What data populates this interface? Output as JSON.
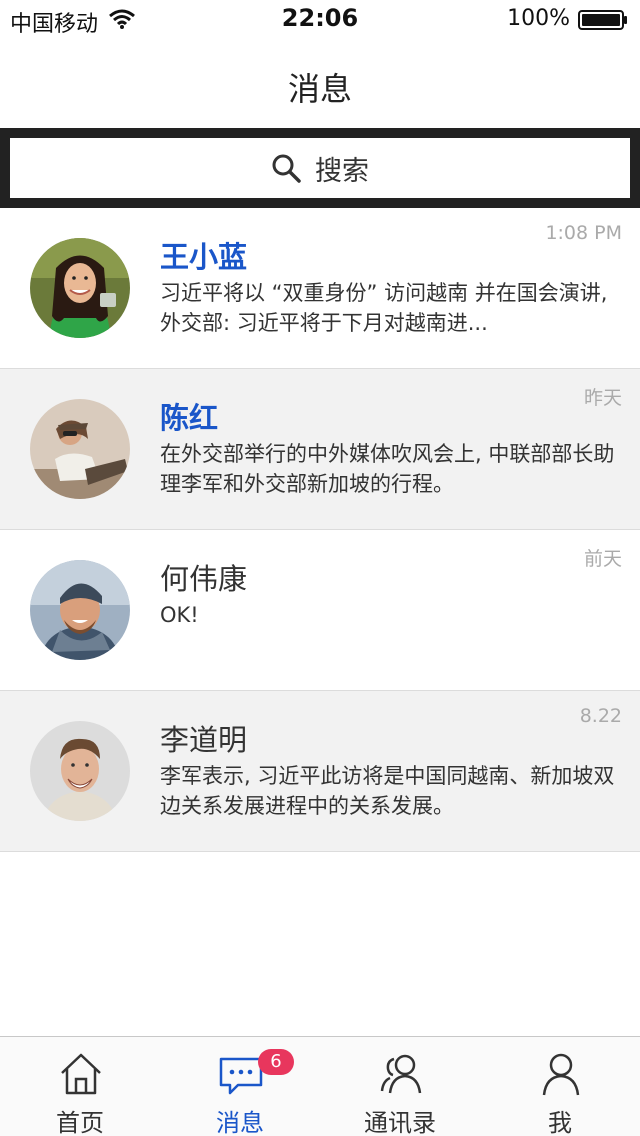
{
  "status": {
    "carrier": "中国移动",
    "time": "22:06",
    "battery": "100%"
  },
  "nav": {
    "title": "消息"
  },
  "search": {
    "label": "搜索"
  },
  "messages": [
    {
      "name": "王小蓝",
      "time": "1:08 PM",
      "preview": "习近平将以 “双重身份” 访问越南 并在国会演讲, 外交部: 习近平将于下月对越南进...",
      "highlight": true
    },
    {
      "name": "陈红",
      "time": "昨天",
      "preview": "在外交部举行的中外媒体吹风会上, 中联部部长助理李军和外交部新加坡的行程。",
      "highlight": true
    },
    {
      "name": "何伟康",
      "time": "前天",
      "preview": "OK!",
      "highlight": false
    },
    {
      "name": "李道明",
      "time": "8.22",
      "preview": "李军表示, 习近平此访将是中国同越南、新加坡双边关系发展进程中的关系发展。",
      "highlight": false
    }
  ],
  "tabs": [
    {
      "label": "首页",
      "icon": "home-icon"
    },
    {
      "label": "消息",
      "icon": "chat-icon",
      "badge": "6"
    },
    {
      "label": "通讯录",
      "icon": "contacts-icon"
    },
    {
      "label": "我",
      "icon": "person-icon"
    }
  ],
  "colors": {
    "accent": "#1a56c9",
    "badge": "#e8365d",
    "search_frame": "#222222",
    "alt_row": "#f2f2f2"
  }
}
